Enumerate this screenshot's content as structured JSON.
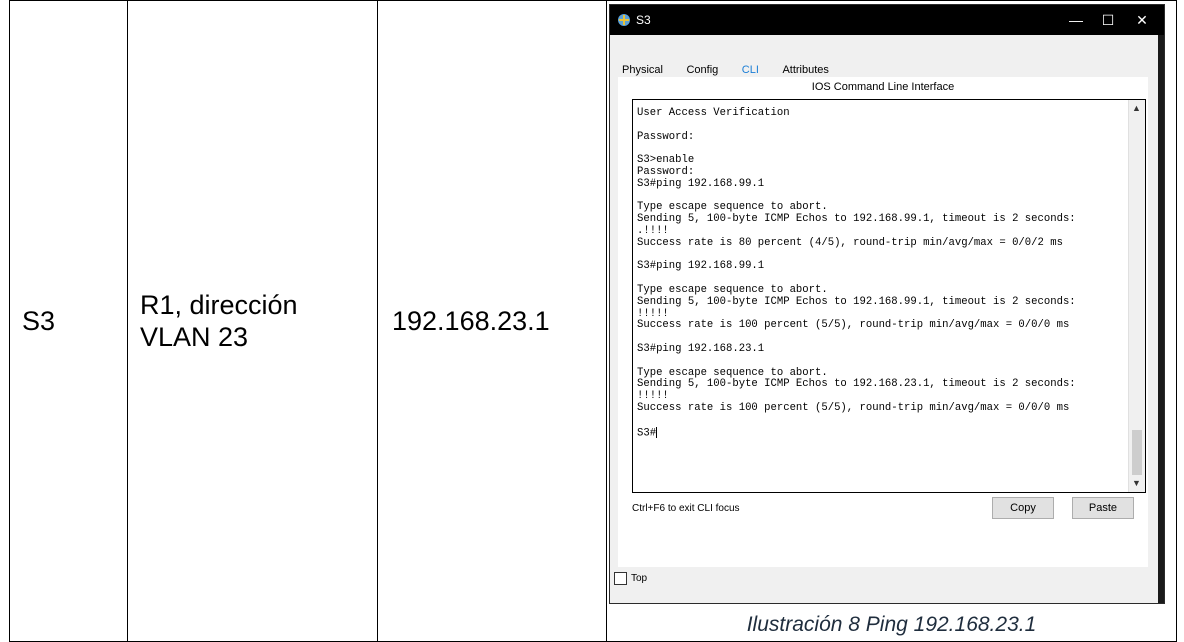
{
  "table": {
    "device": "S3",
    "destination": "R1, dirección VLAN 23",
    "ip": "192.168.23.1"
  },
  "window": {
    "title": "S3",
    "tabs": [
      "Physical",
      "Config",
      "CLI",
      "Attributes"
    ],
    "active_tab": "CLI",
    "cli_heading": "IOS Command Line Interface",
    "cli_lines": [
      "User Access Verification",
      "",
      "Password:",
      "",
      "S3>enable",
      "Password:",
      "S3#ping 192.168.99.1",
      "",
      "Type escape sequence to abort.",
      "Sending 5, 100-byte ICMP Echos to 192.168.99.1, timeout is 2 seconds:",
      ".!!!!",
      "Success rate is 80 percent (4/5), round-trip min/avg/max = 0/0/2 ms",
      "",
      "S3#ping 192.168.99.1",
      "",
      "Type escape sequence to abort.",
      "Sending 5, 100-byte ICMP Echos to 192.168.99.1, timeout is 2 seconds:",
      "!!!!!",
      "Success rate is 100 percent (5/5), round-trip min/avg/max = 0/0/0 ms",
      "",
      "S3#ping 192.168.23.1",
      "",
      "Type escape sequence to abort.",
      "Sending 5, 100-byte ICMP Echos to 192.168.23.1, timeout is 2 seconds:",
      "!!!!!",
      "Success rate is 100 percent (5/5), round-trip min/avg/max = 0/0/0 ms",
      ""
    ],
    "prompt": "S3#",
    "focus_hint": "Ctrl+F6 to exit CLI focus",
    "copy_label": "Copy",
    "paste_label": "Paste",
    "top_label": "Top",
    "controls": {
      "minimize": "—",
      "maximize": "☐",
      "close": "✕"
    }
  },
  "caption": "Ilustración 8 Ping 192.168.23.1",
  "colors": {
    "accent": "#1b7ed6",
    "titlebar": "#000000"
  }
}
